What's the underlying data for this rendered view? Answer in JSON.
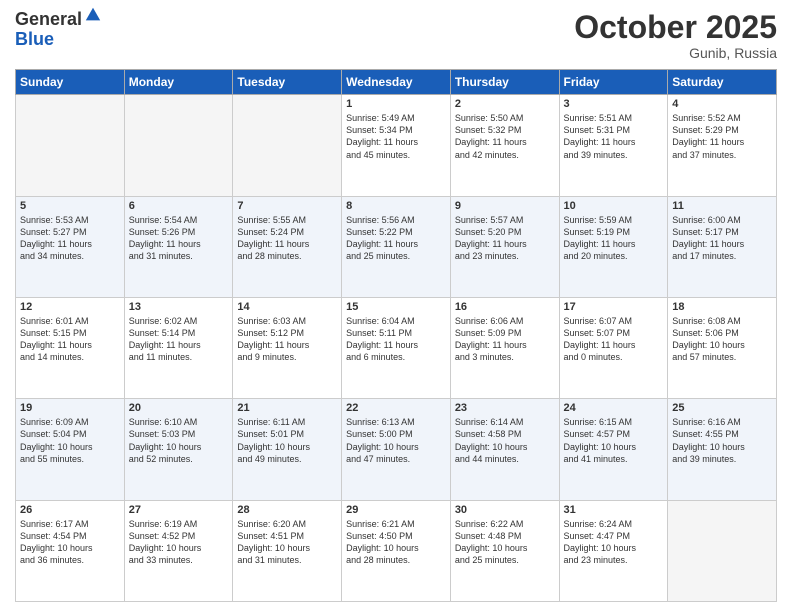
{
  "header": {
    "logo_general": "General",
    "logo_blue": "Blue",
    "month": "October 2025",
    "location": "Gunib, Russia"
  },
  "weekdays": [
    "Sunday",
    "Monday",
    "Tuesday",
    "Wednesday",
    "Thursday",
    "Friday",
    "Saturday"
  ],
  "weeks": [
    [
      {
        "day": "",
        "info": ""
      },
      {
        "day": "",
        "info": ""
      },
      {
        "day": "",
        "info": ""
      },
      {
        "day": "1",
        "info": "Sunrise: 5:49 AM\nSunset: 5:34 PM\nDaylight: 11 hours\nand 45 minutes."
      },
      {
        "day": "2",
        "info": "Sunrise: 5:50 AM\nSunset: 5:32 PM\nDaylight: 11 hours\nand 42 minutes."
      },
      {
        "day": "3",
        "info": "Sunrise: 5:51 AM\nSunset: 5:31 PM\nDaylight: 11 hours\nand 39 minutes."
      },
      {
        "day": "4",
        "info": "Sunrise: 5:52 AM\nSunset: 5:29 PM\nDaylight: 11 hours\nand 37 minutes."
      }
    ],
    [
      {
        "day": "5",
        "info": "Sunrise: 5:53 AM\nSunset: 5:27 PM\nDaylight: 11 hours\nand 34 minutes."
      },
      {
        "day": "6",
        "info": "Sunrise: 5:54 AM\nSunset: 5:26 PM\nDaylight: 11 hours\nand 31 minutes."
      },
      {
        "day": "7",
        "info": "Sunrise: 5:55 AM\nSunset: 5:24 PM\nDaylight: 11 hours\nand 28 minutes."
      },
      {
        "day": "8",
        "info": "Sunrise: 5:56 AM\nSunset: 5:22 PM\nDaylight: 11 hours\nand 25 minutes."
      },
      {
        "day": "9",
        "info": "Sunrise: 5:57 AM\nSunset: 5:20 PM\nDaylight: 11 hours\nand 23 minutes."
      },
      {
        "day": "10",
        "info": "Sunrise: 5:59 AM\nSunset: 5:19 PM\nDaylight: 11 hours\nand 20 minutes."
      },
      {
        "day": "11",
        "info": "Sunrise: 6:00 AM\nSunset: 5:17 PM\nDaylight: 11 hours\nand 17 minutes."
      }
    ],
    [
      {
        "day": "12",
        "info": "Sunrise: 6:01 AM\nSunset: 5:15 PM\nDaylight: 11 hours\nand 14 minutes."
      },
      {
        "day": "13",
        "info": "Sunrise: 6:02 AM\nSunset: 5:14 PM\nDaylight: 11 hours\nand 11 minutes."
      },
      {
        "day": "14",
        "info": "Sunrise: 6:03 AM\nSunset: 5:12 PM\nDaylight: 11 hours\nand 9 minutes."
      },
      {
        "day": "15",
        "info": "Sunrise: 6:04 AM\nSunset: 5:11 PM\nDaylight: 11 hours\nand 6 minutes."
      },
      {
        "day": "16",
        "info": "Sunrise: 6:06 AM\nSunset: 5:09 PM\nDaylight: 11 hours\nand 3 minutes."
      },
      {
        "day": "17",
        "info": "Sunrise: 6:07 AM\nSunset: 5:07 PM\nDaylight: 11 hours\nand 0 minutes."
      },
      {
        "day": "18",
        "info": "Sunrise: 6:08 AM\nSunset: 5:06 PM\nDaylight: 10 hours\nand 57 minutes."
      }
    ],
    [
      {
        "day": "19",
        "info": "Sunrise: 6:09 AM\nSunset: 5:04 PM\nDaylight: 10 hours\nand 55 minutes."
      },
      {
        "day": "20",
        "info": "Sunrise: 6:10 AM\nSunset: 5:03 PM\nDaylight: 10 hours\nand 52 minutes."
      },
      {
        "day": "21",
        "info": "Sunrise: 6:11 AM\nSunset: 5:01 PM\nDaylight: 10 hours\nand 49 minutes."
      },
      {
        "day": "22",
        "info": "Sunrise: 6:13 AM\nSunset: 5:00 PM\nDaylight: 10 hours\nand 47 minutes."
      },
      {
        "day": "23",
        "info": "Sunrise: 6:14 AM\nSunset: 4:58 PM\nDaylight: 10 hours\nand 44 minutes."
      },
      {
        "day": "24",
        "info": "Sunrise: 6:15 AM\nSunset: 4:57 PM\nDaylight: 10 hours\nand 41 minutes."
      },
      {
        "day": "25",
        "info": "Sunrise: 6:16 AM\nSunset: 4:55 PM\nDaylight: 10 hours\nand 39 minutes."
      }
    ],
    [
      {
        "day": "26",
        "info": "Sunrise: 6:17 AM\nSunset: 4:54 PM\nDaylight: 10 hours\nand 36 minutes."
      },
      {
        "day": "27",
        "info": "Sunrise: 6:19 AM\nSunset: 4:52 PM\nDaylight: 10 hours\nand 33 minutes."
      },
      {
        "day": "28",
        "info": "Sunrise: 6:20 AM\nSunset: 4:51 PM\nDaylight: 10 hours\nand 31 minutes."
      },
      {
        "day": "29",
        "info": "Sunrise: 6:21 AM\nSunset: 4:50 PM\nDaylight: 10 hours\nand 28 minutes."
      },
      {
        "day": "30",
        "info": "Sunrise: 6:22 AM\nSunset: 4:48 PM\nDaylight: 10 hours\nand 25 minutes."
      },
      {
        "day": "31",
        "info": "Sunrise: 6:24 AM\nSunset: 4:47 PM\nDaylight: 10 hours\nand 23 minutes."
      },
      {
        "day": "",
        "info": ""
      }
    ]
  ]
}
